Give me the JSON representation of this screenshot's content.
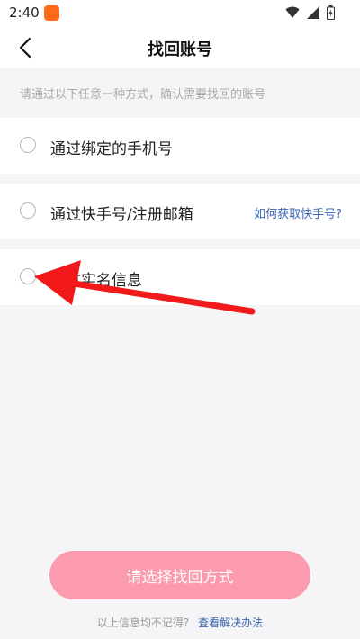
{
  "status_bar": {
    "time": "2:40",
    "app_icon": "kuaishou-app-icon",
    "icons": [
      "wifi-icon",
      "signal-icon",
      "battery-icon"
    ]
  },
  "header": {
    "back_icon": "chevron-left-icon",
    "title": "找回账号"
  },
  "hint": "请通过以下任意一种方式，确认需要找回的账号",
  "options": [
    {
      "label": "通过绑定的手机号"
    },
    {
      "label": "通过快手号/注册邮箱",
      "link": "如何获取快手号?"
    },
    {
      "label": "通过实名信息"
    }
  ],
  "submit_label": "请选择找回方式",
  "footer": {
    "text": "以上信息均不记得?",
    "link": "查看解决办法"
  },
  "colors": {
    "accent_pink": "#fc9aae",
    "link_blue": "#3a65b5",
    "annotation_red": "#f2191b",
    "app_badge": "#ff6a1a"
  }
}
